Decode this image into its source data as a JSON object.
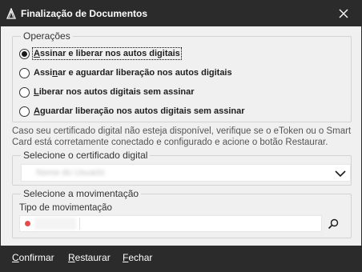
{
  "window": {
    "title": "Finalização de Documentos"
  },
  "operations": {
    "legend": "Operações",
    "options": [
      {
        "mnemonic": "A",
        "rest": "ssinar e liberar nos autos digitais",
        "checked": true
      },
      {
        "pre": "Assi",
        "mnemonic": "n",
        "rest": "ar e aguardar liberação nos autos digitais",
        "checked": false
      },
      {
        "mnemonic": "L",
        "rest": "iberar nos autos digitais sem assinar",
        "checked": false
      },
      {
        "mnemonic": "A",
        "rest": "guardar liberação nos autos digitais sem assinar",
        "checked": false
      }
    ]
  },
  "info_text": "Caso seu certificado digital não esteja disponível, verifique se o eToken ou o Smart Card está corretamente conectado e configurado e acione o botão Restaurar.",
  "certificate": {
    "legend": "Selecione o certificado digital",
    "selected_value": "Nome do Usuario"
  },
  "movement": {
    "legend": "Selecione a movimentação",
    "field_label": "Tipo de movimentação",
    "value": ""
  },
  "footer": {
    "confirm_mnemonic": "C",
    "confirm_rest": "onfirmar",
    "restore_mnemonic": "R",
    "restore_rest": "estaurar",
    "close_mnemonic": "F",
    "close_rest": "echar"
  },
  "colors": {
    "titlebar": "#2b2b2b",
    "window_bg": "#f0f0f0",
    "required_dot": "#e74c4c"
  }
}
